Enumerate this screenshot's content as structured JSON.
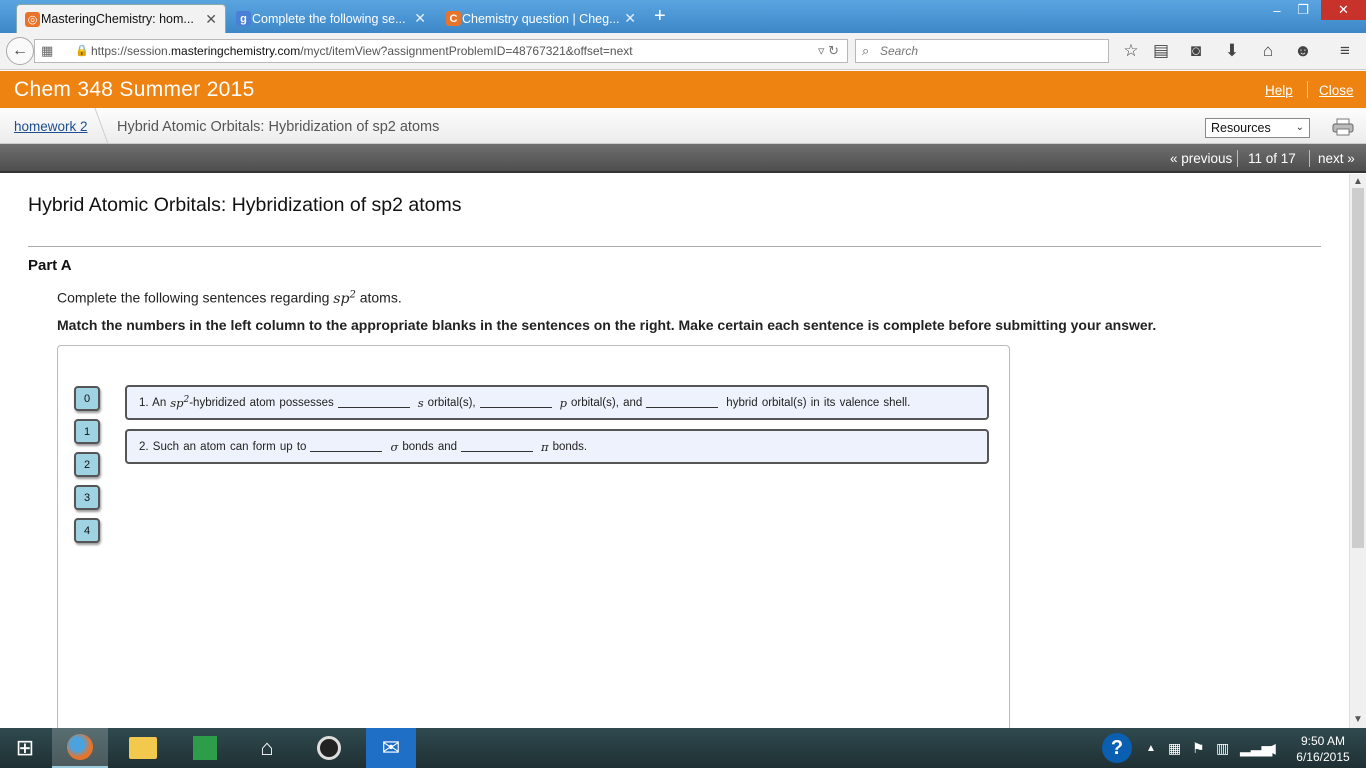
{
  "browser": {
    "tabs": [
      {
        "label": "MasteringChemistry: hom...",
        "icon": "mastering-icon"
      },
      {
        "label": "Complete the following se...",
        "icon": "google-icon"
      },
      {
        "label": "Chemistry question | Cheg...",
        "icon": "chegg-icon"
      }
    ],
    "url_prefix": "https://session.",
    "url_domain": "masteringchemistry.com",
    "url_path": "/myct/itemView?assignmentProblemID=48767321&offset=next",
    "search_placeholder": "Search"
  },
  "header": {
    "course_title": "Chem 348 Summer 2015",
    "help_label": "Help",
    "close_label": "Close"
  },
  "breadcrumb": {
    "home": "homework 2",
    "current": "Hybrid Atomic Orbitals: Hybridization of sp2 atoms",
    "resources": "Resources"
  },
  "pager": {
    "previous": "« previous",
    "position": "11 of 17",
    "next": "next »"
  },
  "problem": {
    "title": "Hybrid Atomic Orbitals: Hybridization of sp2 atoms",
    "part": "Part A",
    "intro_before": "Complete the following sentences regarding",
    "intro_math": "sp",
    "intro_sup": "2",
    "intro_after": "atoms.",
    "instruction": "Match the numbers in the left column to the appropriate blanks in the sentences on the right. Make certain each sentence is complete before submitting your answer.",
    "numbers": [
      "0",
      "1",
      "2",
      "3",
      "4"
    ],
    "sentence1": {
      "start": "1. An",
      "math": "sp",
      "sup": "2",
      "part1": "-hybridized atom possesses",
      "s": "s",
      "part2": "orbital(s),",
      "p": "p",
      "part3": "orbital(s), and",
      "part4": "hybrid orbital(s) in its valence shell."
    },
    "sentence2": {
      "start": "2. Such an atom can form up to",
      "sigma": "σ",
      "part1": "bonds and",
      "pi": "π",
      "part2": "bonds."
    }
  },
  "taskbar": {
    "time": "9:50 AM",
    "date": "6/16/2015"
  }
}
